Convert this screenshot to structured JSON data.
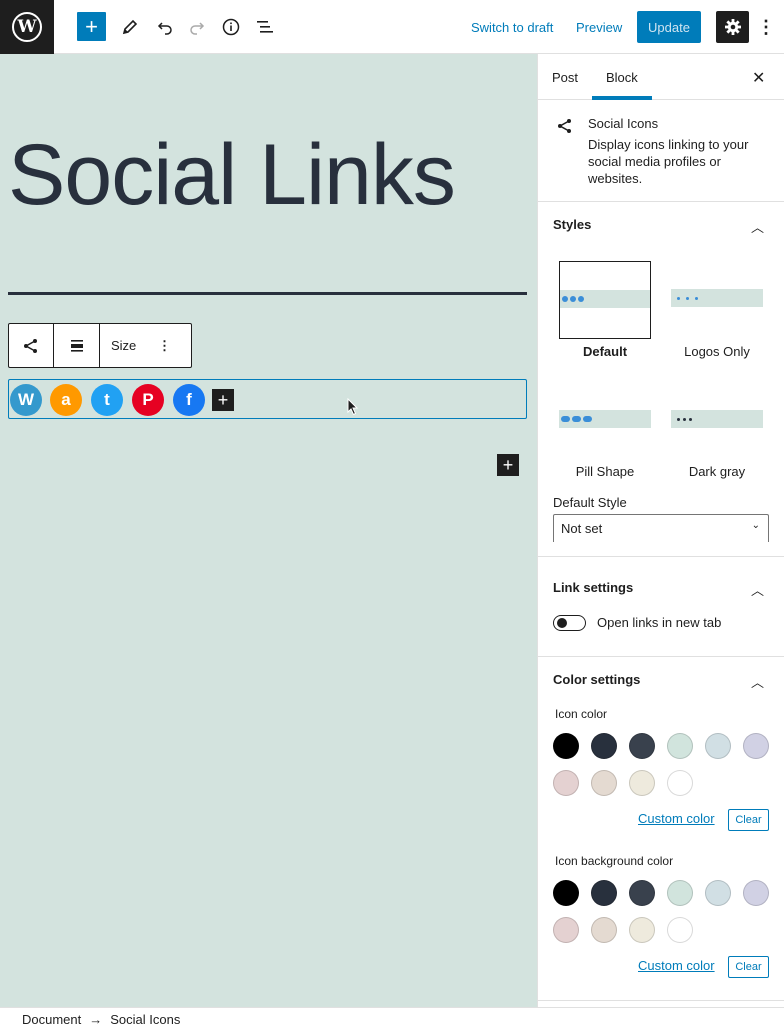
{
  "topbar": {
    "logo": "W",
    "inserter_icon": "+",
    "switch_to_draft": "Switch to draft",
    "preview": "Preview",
    "update": "Update",
    "more_icon": "⋮"
  },
  "canvas": {
    "title": "Social Links",
    "toolbar": {
      "size_label": "Size",
      "more": "⋮"
    },
    "social_icons": [
      {
        "name": "WordPress",
        "glyph": "W",
        "color": "#3499cd"
      },
      {
        "name": "Amazon",
        "glyph": "a",
        "color": "#f90"
      },
      {
        "name": "Twitter",
        "glyph": "t",
        "color": "#21a1f3"
      },
      {
        "name": "Pinterest",
        "glyph": "P",
        "color": "#e60122"
      },
      {
        "name": "Facebook",
        "glyph": "f",
        "color": "#1778f2"
      }
    ],
    "add_glyph": "+"
  },
  "sidebar": {
    "tabs": [
      "Post",
      "Block"
    ],
    "close": "✕",
    "block_card": {
      "title": "Social Icons",
      "description": "Display icons linking to your social media profiles or websites."
    },
    "styles": {
      "heading": "Styles",
      "options": [
        "Default",
        "Logos Only",
        "Pill Shape",
        "Dark gray"
      ],
      "default_style_label": "Default Style",
      "default_style_value": "Not set"
    },
    "link_settings": {
      "heading": "Link settings",
      "toggle_label": "Open links in new tab"
    },
    "color_settings": {
      "heading": "Color settings",
      "icon_color_label": "Icon color",
      "icon_bg_label": "Icon background color",
      "custom_color": "Custom color",
      "clear": "Clear",
      "palette": [
        "#000000",
        "#28303d",
        "#39414d",
        "#d1e4dd",
        "#d1dfe4",
        "#d1d1e4",
        "#e4d1d1",
        "#e4dad1",
        "#eeeadd",
        "#ffffff"
      ]
    }
  },
  "footer": {
    "crumbs": [
      "Document",
      "Social Icons"
    ],
    "separator": "→"
  },
  "colors": {
    "accent": "#007cba",
    "canvas_bg": "#d3e3de",
    "dark": "#1e1e1e"
  }
}
